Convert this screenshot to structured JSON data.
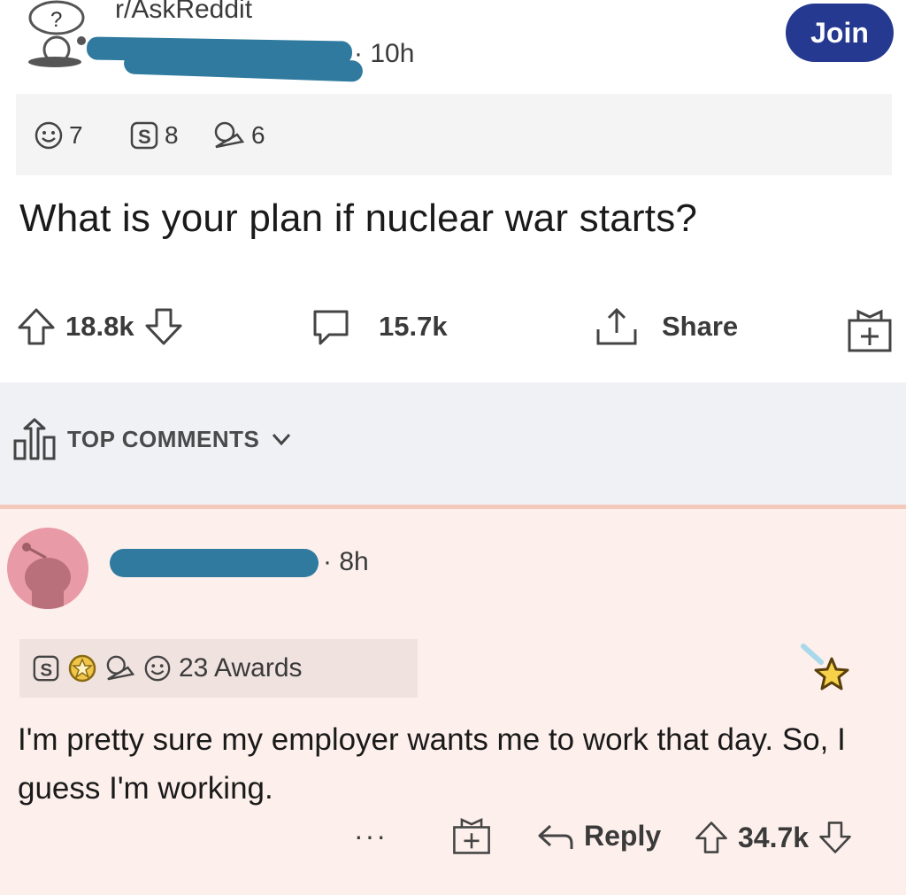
{
  "post": {
    "subreddit": "r/AskReddit",
    "age": "· 10h",
    "join_label": "Join",
    "awards": [
      {
        "icon": "wholesome-award-icon",
        "count": "7"
      },
      {
        "icon": "silver-award-icon",
        "count": "8"
      },
      {
        "icon": "helpful-award-icon",
        "count": "6"
      }
    ],
    "title": "What is your plan if nuclear war starts?",
    "upvotes": "18.8k",
    "comments": "15.7k",
    "share_label": "Share"
  },
  "sort": {
    "label": "TOP COMMENTS"
  },
  "comment": {
    "age": "· 8h",
    "awards_label": "23 Awards",
    "body": "I'm pretty sure my employer wants me to work that day. So, I guess I'm working.",
    "more": "···",
    "reply_label": "Reply",
    "score": "34.7k"
  },
  "colors": {
    "join_bg": "#24398f",
    "redaction": "#2f7a9e",
    "comment_bg": "#fdf0ec",
    "avatar_bg": "#e89aa7"
  }
}
